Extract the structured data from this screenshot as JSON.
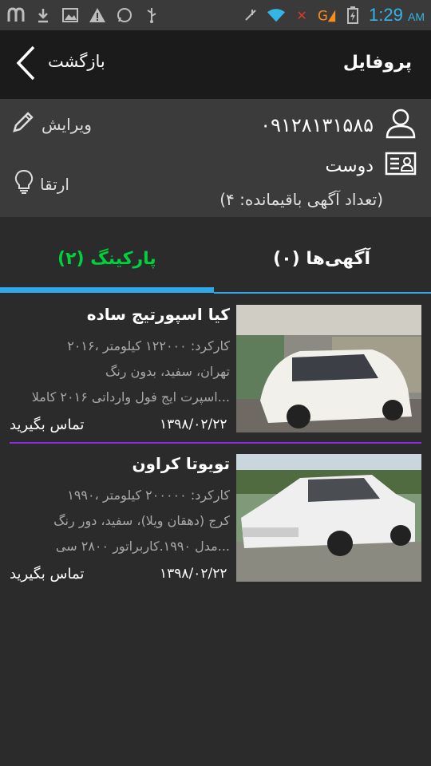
{
  "statusbar": {
    "time": "1:29",
    "ampm": "AM",
    "icons": [
      "m-app-icon",
      "download-icon",
      "image-icon",
      "warning-icon",
      "whatsapp-icon",
      "usb-icon",
      "mute-icon",
      "wifi-icon",
      "signal-icon",
      "battery-icon"
    ]
  },
  "appbar": {
    "back_label": "بازگشت",
    "title": "پروفایل"
  },
  "profile": {
    "phone": "۰۹۱۲۸۱۳۱۵۸۵",
    "role": "دوست",
    "remaining": "(تعداد آگهی باقیمانده: ۴)",
    "edit_label": "ویرایش",
    "upgrade_label": "ارتقا"
  },
  "tabs": {
    "ads": "آگهی‌ها (۰)",
    "parking": "پارکینگ (۲)"
  },
  "colors": {
    "active_tab": "#00d23c",
    "accent": "#2fa7e8",
    "divider": "#8a2be2",
    "status_time": "#33b5e5"
  },
  "items": [
    {
      "title": "کیا اسپورتیج ساده",
      "line1": "۲۰۱۶، کارکرد: ۱۲۲۰۰۰ کیلومتر",
      "line2": "تهران، سفید، بدون رنگ",
      "line3": "اسپرت ایج فول وارداتی ۲۰۱۶ کاملا...",
      "date": "۱۳۹۸/۰۲/۲۲",
      "contact": "تماس بگیرید"
    },
    {
      "title": "تویوتا کراون",
      "line1": "۱۹۹۰، کارکرد: ۲۰۰۰۰۰ کیلومتر",
      "line2": "کرج (دهقان ویلا)، سفید، دور رنگ",
      "line3": "مدل ۱۹۹۰.کاربراتور ۲۸۰۰ سی...",
      "date": "۱۳۹۸/۰۲/۲۲",
      "contact": "تماس بگیرید"
    }
  ]
}
